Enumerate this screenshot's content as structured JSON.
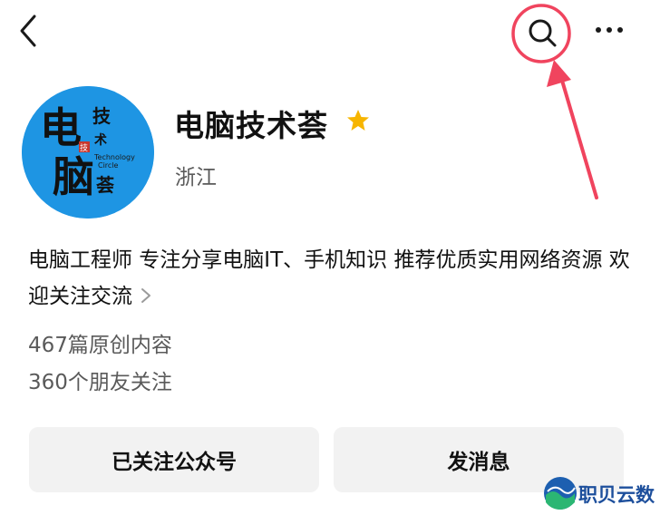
{
  "profile": {
    "name": "电脑技术荟",
    "region": "浙江",
    "avatar_text": {
      "big_char_1": "电",
      "big_char_2": "脑",
      "small_chars": [
        "技",
        "术",
        "荟"
      ],
      "seal_char": "技",
      "english_line_1": "Technology",
      "english_line_2": "Circle"
    },
    "intro": "电脑工程师 专注分享电脑IT、手机知识 推荐优质实用网络资源 欢迎关注交流",
    "articles_count": "467篇原创内容",
    "followers_count": "360个朋友关注",
    "verified_icon": "star-icon",
    "star_color": "#f7b500"
  },
  "actions": {
    "followed_label": "已关注公众号",
    "message_label": "发消息"
  },
  "topbar": {
    "back_icon": "chevron-left-icon",
    "search_icon": "search-icon",
    "more_icon": "more-dots-icon"
  },
  "annotation": {
    "color": "#f0445e",
    "target": "search-button"
  },
  "watermark": {
    "text": "职贝云数"
  }
}
